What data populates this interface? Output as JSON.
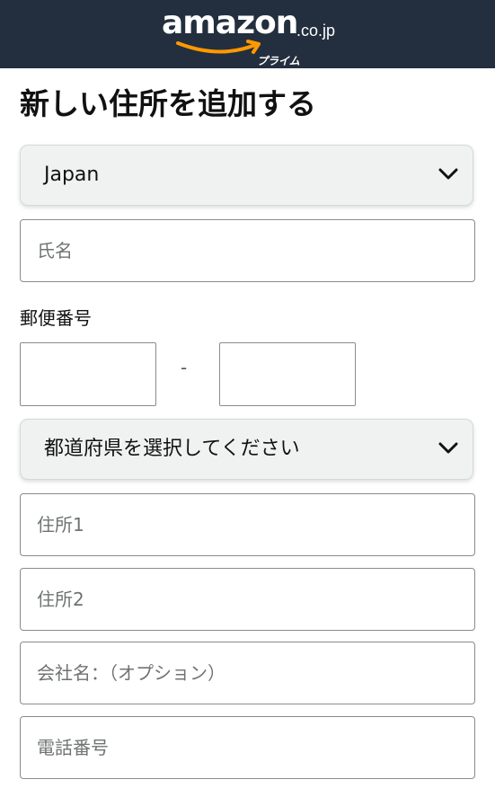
{
  "header": {
    "logo_word": "amazon",
    "logo_tld": ".co.jp",
    "logo_prime": "プライム"
  },
  "page_title": "新しい住所を追加する",
  "country_select": {
    "value": "Japan"
  },
  "full_name": {
    "placeholder": "氏名",
    "value": ""
  },
  "postal_code": {
    "label": "郵便番号",
    "separator": "-",
    "part1": "",
    "part2": ""
  },
  "prefecture_select": {
    "value": "都道府県を選択してください"
  },
  "address_line1": {
    "placeholder": "住所1",
    "value": ""
  },
  "address_line2": {
    "placeholder": "住所2",
    "value": ""
  },
  "company": {
    "placeholder": "会社名：（オプション）",
    "value": ""
  },
  "phone": {
    "placeholder": "電話番号",
    "value": ""
  },
  "colors": {
    "header_bg": "#232f3e",
    "smile": "#ff9900",
    "select_bg": "#f0f2f2",
    "input_border": "#888c8c"
  },
  "icons": [
    "chevron-down-icon",
    "amazon-smile-icon"
  ]
}
